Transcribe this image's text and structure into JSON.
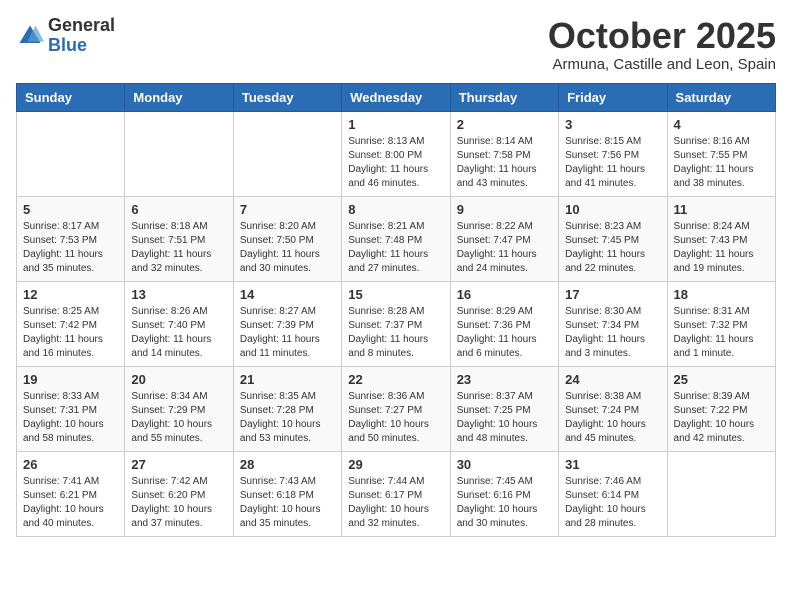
{
  "header": {
    "logo_general": "General",
    "logo_blue": "Blue",
    "title": "October 2025",
    "subtitle": "Armuna, Castille and Leon, Spain"
  },
  "days_of_week": [
    "Sunday",
    "Monday",
    "Tuesday",
    "Wednesday",
    "Thursday",
    "Friday",
    "Saturday"
  ],
  "weeks": [
    [
      {
        "day": "",
        "info": ""
      },
      {
        "day": "",
        "info": ""
      },
      {
        "day": "",
        "info": ""
      },
      {
        "day": "1",
        "info": "Sunrise: 8:13 AM\nSunset: 8:00 PM\nDaylight: 11 hours and 46 minutes."
      },
      {
        "day": "2",
        "info": "Sunrise: 8:14 AM\nSunset: 7:58 PM\nDaylight: 11 hours and 43 minutes."
      },
      {
        "day": "3",
        "info": "Sunrise: 8:15 AM\nSunset: 7:56 PM\nDaylight: 11 hours and 41 minutes."
      },
      {
        "day": "4",
        "info": "Sunrise: 8:16 AM\nSunset: 7:55 PM\nDaylight: 11 hours and 38 minutes."
      }
    ],
    [
      {
        "day": "5",
        "info": "Sunrise: 8:17 AM\nSunset: 7:53 PM\nDaylight: 11 hours and 35 minutes."
      },
      {
        "day": "6",
        "info": "Sunrise: 8:18 AM\nSunset: 7:51 PM\nDaylight: 11 hours and 32 minutes."
      },
      {
        "day": "7",
        "info": "Sunrise: 8:20 AM\nSunset: 7:50 PM\nDaylight: 11 hours and 30 minutes."
      },
      {
        "day": "8",
        "info": "Sunrise: 8:21 AM\nSunset: 7:48 PM\nDaylight: 11 hours and 27 minutes."
      },
      {
        "day": "9",
        "info": "Sunrise: 8:22 AM\nSunset: 7:47 PM\nDaylight: 11 hours and 24 minutes."
      },
      {
        "day": "10",
        "info": "Sunrise: 8:23 AM\nSunset: 7:45 PM\nDaylight: 11 hours and 22 minutes."
      },
      {
        "day": "11",
        "info": "Sunrise: 8:24 AM\nSunset: 7:43 PM\nDaylight: 11 hours and 19 minutes."
      }
    ],
    [
      {
        "day": "12",
        "info": "Sunrise: 8:25 AM\nSunset: 7:42 PM\nDaylight: 11 hours and 16 minutes."
      },
      {
        "day": "13",
        "info": "Sunrise: 8:26 AM\nSunset: 7:40 PM\nDaylight: 11 hours and 14 minutes."
      },
      {
        "day": "14",
        "info": "Sunrise: 8:27 AM\nSunset: 7:39 PM\nDaylight: 11 hours and 11 minutes."
      },
      {
        "day": "15",
        "info": "Sunrise: 8:28 AM\nSunset: 7:37 PM\nDaylight: 11 hours and 8 minutes."
      },
      {
        "day": "16",
        "info": "Sunrise: 8:29 AM\nSunset: 7:36 PM\nDaylight: 11 hours and 6 minutes."
      },
      {
        "day": "17",
        "info": "Sunrise: 8:30 AM\nSunset: 7:34 PM\nDaylight: 11 hours and 3 minutes."
      },
      {
        "day": "18",
        "info": "Sunrise: 8:31 AM\nSunset: 7:32 PM\nDaylight: 11 hours and 1 minute."
      }
    ],
    [
      {
        "day": "19",
        "info": "Sunrise: 8:33 AM\nSunset: 7:31 PM\nDaylight: 10 hours and 58 minutes."
      },
      {
        "day": "20",
        "info": "Sunrise: 8:34 AM\nSunset: 7:29 PM\nDaylight: 10 hours and 55 minutes."
      },
      {
        "day": "21",
        "info": "Sunrise: 8:35 AM\nSunset: 7:28 PM\nDaylight: 10 hours and 53 minutes."
      },
      {
        "day": "22",
        "info": "Sunrise: 8:36 AM\nSunset: 7:27 PM\nDaylight: 10 hours and 50 minutes."
      },
      {
        "day": "23",
        "info": "Sunrise: 8:37 AM\nSunset: 7:25 PM\nDaylight: 10 hours and 48 minutes."
      },
      {
        "day": "24",
        "info": "Sunrise: 8:38 AM\nSunset: 7:24 PM\nDaylight: 10 hours and 45 minutes."
      },
      {
        "day": "25",
        "info": "Sunrise: 8:39 AM\nSunset: 7:22 PM\nDaylight: 10 hours and 42 minutes."
      }
    ],
    [
      {
        "day": "26",
        "info": "Sunrise: 7:41 AM\nSunset: 6:21 PM\nDaylight: 10 hours and 40 minutes."
      },
      {
        "day": "27",
        "info": "Sunrise: 7:42 AM\nSunset: 6:20 PM\nDaylight: 10 hours and 37 minutes."
      },
      {
        "day": "28",
        "info": "Sunrise: 7:43 AM\nSunset: 6:18 PM\nDaylight: 10 hours and 35 minutes."
      },
      {
        "day": "29",
        "info": "Sunrise: 7:44 AM\nSunset: 6:17 PM\nDaylight: 10 hours and 32 minutes."
      },
      {
        "day": "30",
        "info": "Sunrise: 7:45 AM\nSunset: 6:16 PM\nDaylight: 10 hours and 30 minutes."
      },
      {
        "day": "31",
        "info": "Sunrise: 7:46 AM\nSunset: 6:14 PM\nDaylight: 10 hours and 28 minutes."
      },
      {
        "day": "",
        "info": ""
      }
    ]
  ]
}
